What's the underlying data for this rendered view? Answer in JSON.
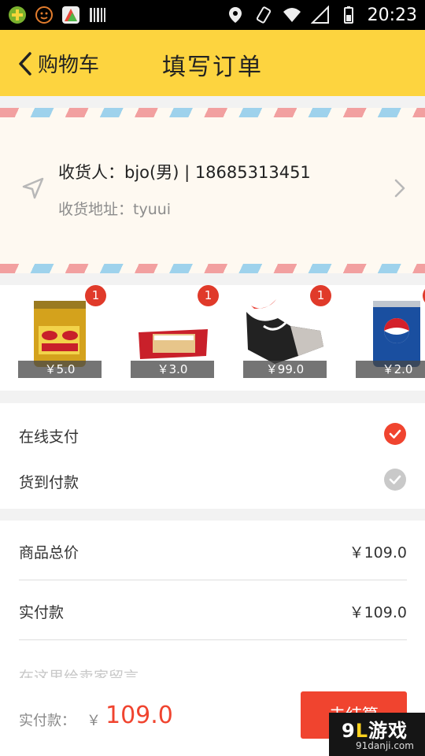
{
  "status_bar": {
    "time": "20:23",
    "left_icons": [
      "plus-app-icon",
      "emoji-app-icon",
      "game-app-icon",
      "barcode-icon"
    ],
    "right_icons": [
      "location-icon",
      "vibrate-icon",
      "wifi-icon",
      "signal-icon",
      "battery-icon"
    ]
  },
  "header": {
    "back_label": "购物车",
    "title": "填写订单",
    "color": "#fdd43f"
  },
  "address": {
    "receiver_line": "收货人：bjo(男) | 18685313451",
    "address_line": "收货地址：tyuui"
  },
  "products": [
    {
      "name": "red-bull-can",
      "price": "￥5.0",
      "quantity": "1"
    },
    {
      "name": "biscuit-pack",
      "price": "￥3.0",
      "quantity": "1"
    },
    {
      "name": "wrist-guard",
      "price": "￥99.0",
      "quantity": "1"
    },
    {
      "name": "pepsi-can",
      "price": "￥2.0",
      "quantity": "1"
    }
  ],
  "payment": {
    "options": [
      {
        "label": "在线支付",
        "selected": true
      },
      {
        "label": "货到付款",
        "selected": false
      }
    ]
  },
  "summary": {
    "total_label": "商品总价",
    "total_value": "￥109.0",
    "paid_label": "实付款",
    "paid_value": "￥109.0",
    "message_placeholder": "在这里给卖家留言"
  },
  "bottom_bar": {
    "label": "实付款：",
    "currency": "￥",
    "amount": "109.0",
    "checkout_label": "去结算",
    "accent_color": "#f0442f"
  },
  "watermark": {
    "logo_num": "9",
    "logo_mark": "L",
    "logo_text": "游戏",
    "sub": "91danji.com"
  }
}
